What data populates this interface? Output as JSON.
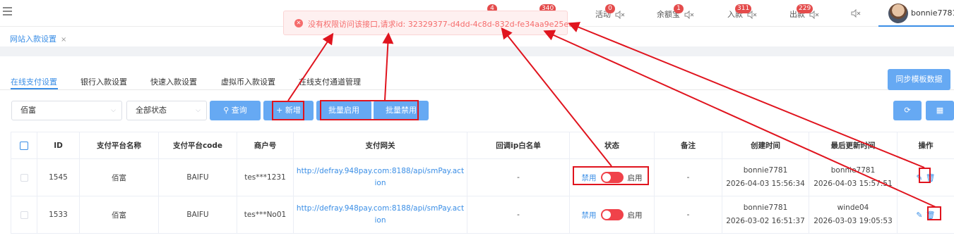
{
  "topbar": {
    "nav": [
      {
        "label": "活动",
        "badge": "0"
      },
      {
        "label": "余额宝",
        "badge": "1"
      },
      {
        "label": "入款",
        "badge": "311"
      },
      {
        "label": "出款",
        "badge": "229"
      }
    ],
    "extra_badges": [
      "4",
      "340"
    ],
    "user": "bonnie7781"
  },
  "page_tab": {
    "label": "网站入款设置",
    "close": "×"
  },
  "toast": {
    "message": "没有权限访问该接口,请求id: 32329377-d4dd-4c8d-832d-fe34aa9e25ee",
    "icon": "error-circle-icon"
  },
  "subtabs": [
    "在线支付设置",
    "银行入款设置",
    "快速入款设置",
    "虚拟币入款设置",
    "在线支付通道管理"
  ],
  "sync_button": "同步模板数据",
  "filters": {
    "platform": "佰富",
    "status": "全部状态",
    "query": "查询",
    "add": "新增",
    "batch_enable": "批量启用",
    "batch_disable": "批量禁用"
  },
  "table": {
    "headers": [
      "ID",
      "支付平台名称",
      "支付平台code",
      "商户号",
      "支付网关",
      "回调ip白名单",
      "状态",
      "备注",
      "创建时间",
      "最后更新时间",
      "操作"
    ],
    "rows": [
      {
        "id": "1545",
        "name": "佰富",
        "code": "BAIFU",
        "merchant": "tes***1231",
        "gateway_1": "http://defray.948pay.com:8188/api/smPay.act",
        "gateway_2": "ion",
        "whitelist": "-",
        "status_off": "禁用",
        "status_on": "启用",
        "note": "-",
        "created_by": "bonnie7781",
        "created_at": "2026-04-03 15:56:34",
        "updated_by": "bonnie7781",
        "updated_at": "2026-04-03 15:57:51"
      },
      {
        "id": "1533",
        "name": "佰富",
        "code": "BAIFU",
        "merchant": "tes***No01",
        "gateway_1": "http://defray.948pay.com:8188/api/smPay.act",
        "gateway_2": "ion",
        "whitelist": "-",
        "status_off": "禁用",
        "status_on": "启用",
        "note": "-",
        "created_by": "bonnie7781",
        "created_at": "2026-03-02 16:51:37",
        "updated_by": "winde04",
        "updated_at": "2026-03-03 19:05:53"
      }
    ]
  },
  "colors": {
    "accent": "#3a8ee6",
    "error": "#f56c6c",
    "annotation": "#e0141e",
    "switch": "#f0424a"
  }
}
